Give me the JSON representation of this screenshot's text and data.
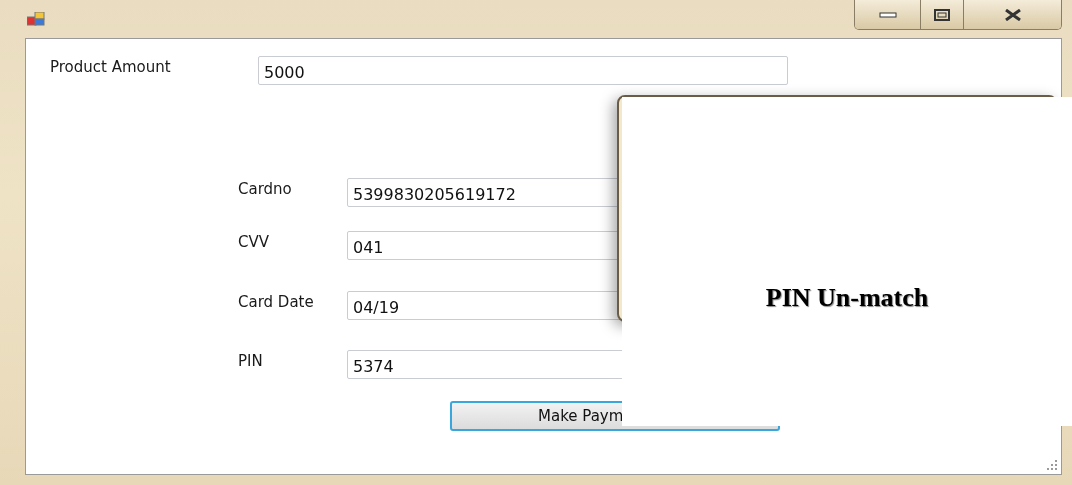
{
  "form": {
    "product_amount": {
      "label": "Product Amount",
      "value": "5000"
    },
    "card_fields": [
      {
        "label": "Cardno",
        "value": "5399830205619172"
      },
      {
        "label": "CVV",
        "value": "041"
      },
      {
        "label": "Card Date",
        "value": "04/19"
      },
      {
        "label": "PIN",
        "value": "5374"
      }
    ],
    "submit_button": "Make Paym"
  },
  "popup": {
    "message": "PIN Un-match"
  }
}
